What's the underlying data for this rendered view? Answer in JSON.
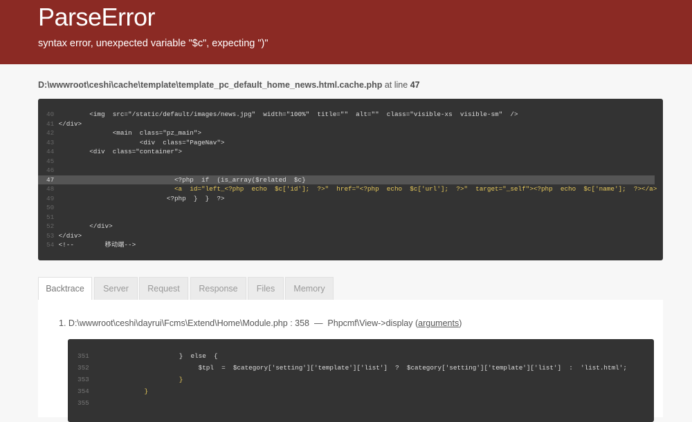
{
  "error": {
    "title": "ParseError",
    "message": "syntax error, unexpected variable \"$c\", expecting \")\""
  },
  "location": {
    "file": "D:\\wwwroot\\ceshi\\cache\\template\\template_pc_default_home_news.html.cache.php",
    "at_line_label": "at line",
    "line": "47"
  },
  "source": {
    "highlight_line": "47",
    "lines": [
      {
        "n": "40",
        "code": "        <img  src=\"/static/default/images/news.jpg\"  width=\"100%\"  title=\"\"  alt=\"\"  class=\"visible-xs  visible-sm\"  />"
      },
      {
        "n": "41",
        "code": "</div>"
      },
      {
        "n": "42",
        "code": "              <main  class=\"pz_main\">"
      },
      {
        "n": "43",
        "code": "                     <div  class=\"PageNav\">"
      },
      {
        "n": "44",
        "code": "        <div  class=\"container\">"
      },
      {
        "n": "45",
        "code": ""
      },
      {
        "n": "46",
        "code": ""
      },
      {
        "n": "47",
        "code": "                              <?php  if  (is_array($related  $c}"
      },
      {
        "n": "48",
        "code": "                              <a  id=\"left_<?php  echo  $c['id'];  ?>\"  href=\"<?php  echo  $c['url'];  ?>\"  target=\"_self\"><?php  echo  $c['name'];  ?></a>"
      },
      {
        "n": "49",
        "code": "                            <?php  }  }  ?>"
      },
      {
        "n": "50",
        "code": ""
      },
      {
        "n": "51",
        "code": ""
      },
      {
        "n": "52",
        "code": "        </div>"
      },
      {
        "n": "53",
        "code": "</div>"
      },
      {
        "n": "54",
        "code": "<!--        移动端-->"
      }
    ]
  },
  "tabs": [
    {
      "label": "Backtrace",
      "active": true
    },
    {
      "label": "Server",
      "active": false
    },
    {
      "label": "Request",
      "active": false
    },
    {
      "label": "Response",
      "active": false
    },
    {
      "label": "Files",
      "active": false
    },
    {
      "label": "Memory",
      "active": false
    }
  ],
  "backtrace": [
    {
      "index": "1.",
      "file": "D:\\wwwroot\\ceshi\\dayrui\\Fcms\\Extend\\Home\\Module.php",
      "line": "358",
      "separator": "—",
      "call": "Phpcmf\\View->display",
      "args_open": "(",
      "args_label": "arguments",
      "args_close": ")",
      "code": [
        {
          "n": "351",
          "code": "                      }  else  {"
        },
        {
          "n": "352",
          "code": "                           $tpl  =  $category['setting']['template']['list']  ?  $category['setting']['template']['list']  :  'list.html';"
        },
        {
          "n": "353",
          "code": "                      }"
        },
        {
          "n": "354",
          "code": "             }"
        },
        {
          "n": "355",
          "code": ""
        }
      ]
    }
  ]
}
